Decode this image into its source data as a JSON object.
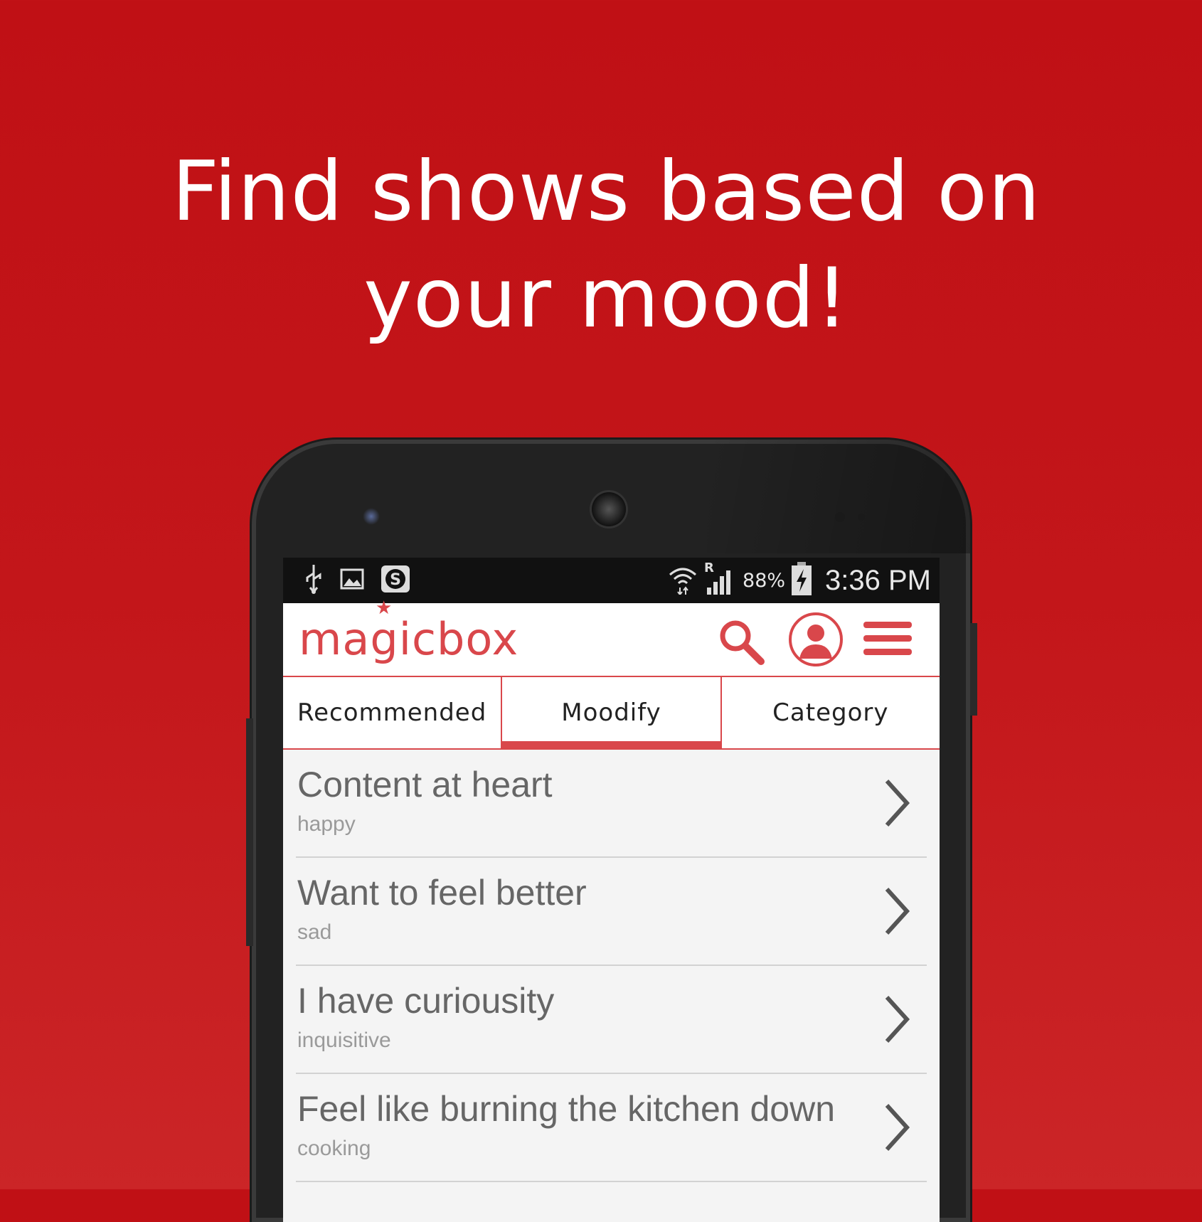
{
  "headline": {
    "line1": "Find shows based on",
    "line2": "your mood!"
  },
  "statusbar": {
    "icons": [
      "usb-icon",
      "image-icon",
      "skype-icon",
      "wifi-icon",
      "signal-icon",
      "battery-charging-icon"
    ],
    "roaming": "R",
    "battery_percent": "88%",
    "time": "3:36 PM"
  },
  "app": {
    "logo": "magicbox",
    "colors": {
      "accent": "#d9474b",
      "background": "#c3161a"
    }
  },
  "tabs": [
    {
      "label": "Recommended",
      "active": false
    },
    {
      "label": "Moodify",
      "active": true
    },
    {
      "label": "Category",
      "active": false
    }
  ],
  "moods": [
    {
      "title": "Content at heart",
      "subtitle": "happy"
    },
    {
      "title": "Want to feel better",
      "subtitle": "sad"
    },
    {
      "title": "I have curiousity",
      "subtitle": "inquisitive"
    },
    {
      "title": "Feel like burning the kitchen down",
      "subtitle": "cooking"
    }
  ]
}
